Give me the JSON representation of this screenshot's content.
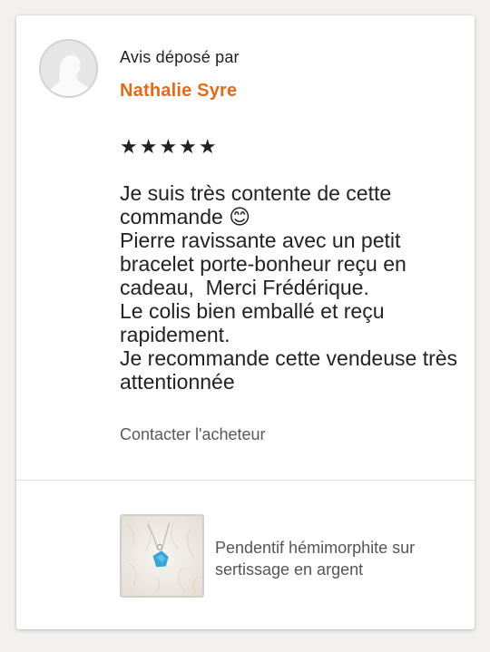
{
  "review": {
    "byline": "Avis déposé par",
    "author": "Nathalie Syre",
    "rating": 5,
    "stars": "★★★★★",
    "text": "Je suis très contente de cette commande 😊\nPierre ravissante avec un petit bracelet porte-bonheur reçu en cadeau,  Merci Frédérique.\nLe colis bien emballé et reçu rapidement.\nJe recommande cette vendeuse très attentionnée",
    "contact_label": "Contacter l'acheteur"
  },
  "product": {
    "name": "Pendentif hémimorphite sur sertissage en argent"
  },
  "colors": {
    "author": "#e06b1f",
    "text": "#222222",
    "muted": "#595959"
  },
  "icons": {
    "avatar": "default-user-silhouette-icon"
  }
}
